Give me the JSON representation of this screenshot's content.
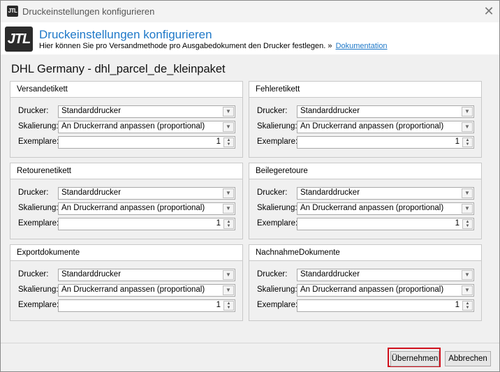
{
  "window": {
    "title": "Druckeinstellungen konfigurieren",
    "app_icon": "JTL",
    "close_glyph": "✕"
  },
  "header": {
    "logo": "JTL",
    "title": "Druckeinstellungen konfigurieren",
    "subtitle": "Hier können Sie pro Versandmethode pro Ausgabedokument den Drucker festlegen. »",
    "doc_link": "Dokumentation"
  },
  "profile_title": "DHL Germany - dhl_parcel_de_kleinpaket",
  "labels": {
    "drucker": "Drucker:",
    "skalierung": "Skalierung:",
    "exemplare": "Exemplare:"
  },
  "groups": [
    {
      "title": "Versandetikett",
      "drucker": "Standarddrucker",
      "skalierung": "An Druckerrand anpassen (proportional)",
      "exemplare": "1"
    },
    {
      "title": "Fehleretikett",
      "drucker": "Standarddrucker",
      "skalierung": "An Druckerrand anpassen (proportional)",
      "exemplare": "1"
    },
    {
      "title": "Retourenetikett",
      "drucker": "Standarddrucker",
      "skalierung": "An Druckerrand anpassen (proportional)",
      "exemplare": "1"
    },
    {
      "title": "Beilegeretoure",
      "drucker": "Standarddrucker",
      "skalierung": "An Druckerrand anpassen (proportional)",
      "exemplare": "1"
    },
    {
      "title": "Exportdokumente",
      "drucker": "Standarddrucker",
      "skalierung": "An Druckerrand anpassen (proportional)",
      "exemplare": "1"
    },
    {
      "title": "NachnahmeDokumente",
      "drucker": "Standarddrucker",
      "skalierung": "An Druckerrand anpassen (proportional)",
      "exemplare": "1"
    }
  ],
  "icons": {
    "dropdown": "chevron-down-icon",
    "spinner": "spinner-arrows-icon"
  },
  "buttons": {
    "apply": "Übernehmen",
    "cancel": "Abbrechen"
  },
  "colors": {
    "accent": "#1e78c8",
    "highlight_frame": "#d0101c"
  }
}
